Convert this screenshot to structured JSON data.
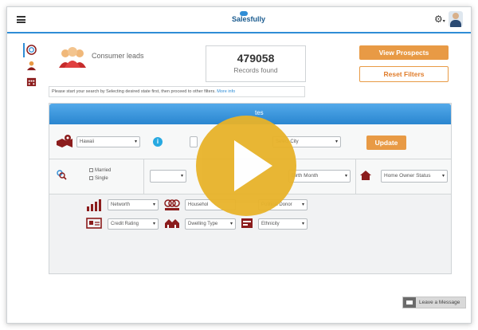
{
  "app": {
    "logo_text": "Salesfully"
  },
  "header": {
    "menu_icon": "hamburger-icon",
    "settings_icon": "gear-icon",
    "settings_caret": "▾"
  },
  "sidebar": {
    "items": [
      {
        "icon": "target-icon"
      },
      {
        "icon": "consumer-icon"
      },
      {
        "icon": "business-icon"
      }
    ]
  },
  "summary": {
    "leads_label": "Consumer leads",
    "records_count": "479058",
    "records_label": "Records found"
  },
  "actions": {
    "view_prospects": "View Prospects",
    "reset_filters": "Reset Filters"
  },
  "hint": {
    "text": "Please start your search by Selecting desired state first, then proceed to other filters.",
    "more_info": "More info"
  },
  "filters": {
    "panel_title_visible": "tes",
    "state": {
      "value": "Hawaii"
    },
    "info_label": "i",
    "city": {
      "placeholder": "Select City"
    },
    "update_label": "Update",
    "marital": {
      "married": "Married",
      "single": "Single"
    },
    "birth_month": {
      "placeholder": "Birth Month"
    },
    "home_owner": {
      "placeholder": "Home Owner Status"
    },
    "networth": {
      "placeholder": "Networth"
    },
    "household": {
      "placeholder": "Househol"
    },
    "donor": {
      "placeholder": "Political Donor"
    },
    "credit": {
      "placeholder": "Credit Rating"
    },
    "dwelling": {
      "placeholder": "Dwelling Type"
    },
    "ethnicity": {
      "placeholder": "Ethnicity"
    }
  },
  "video": {
    "play_icon": "play-icon",
    "color": "#e8b32a"
  },
  "footer": {
    "leave_message": "Leave a Message"
  },
  "colors": {
    "accent": "#2f8dd6",
    "orange": "#e89a45",
    "red_icons": "#8b1c1c"
  }
}
